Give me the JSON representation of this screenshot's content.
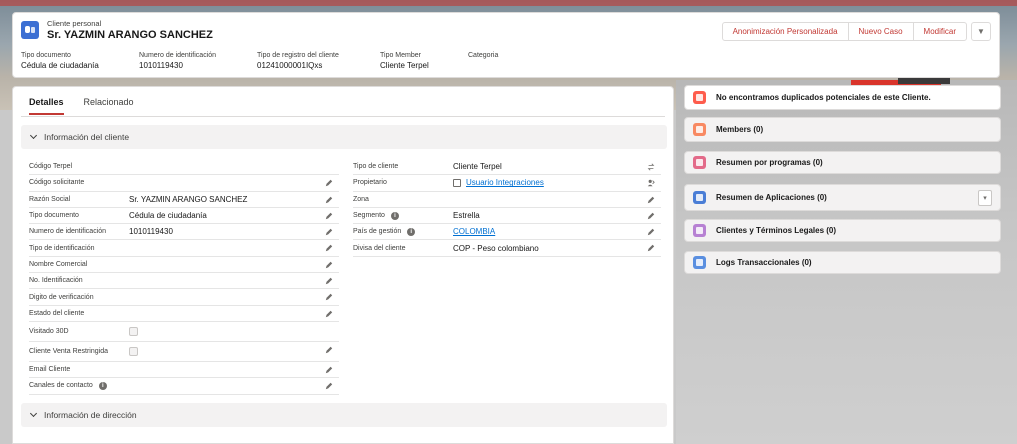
{
  "header": {
    "record_type": "Cliente personal",
    "record_name": "Sr. YAZMIN ARANGO SANCHEZ",
    "actions": [
      "Anonimización Personalizada",
      "Nuevo Caso",
      "Modificar"
    ],
    "highlights": [
      {
        "label": "Tipo documento",
        "value": "Cédula de ciudadanía"
      },
      {
        "label": "Numero de identificación",
        "value": "1010119430"
      },
      {
        "label": "Tipo de registro del cliente",
        "value": "01241000001IQxs"
      },
      {
        "label": "Tipo Member",
        "value": "Cliente Terpel"
      },
      {
        "label": "Categoria",
        "value": ""
      }
    ]
  },
  "tabs": [
    "Detalles",
    "Relacionado"
  ],
  "sections": {
    "client_info": "Información del cliente",
    "address_info": "Información de dirección"
  },
  "left_fields": [
    {
      "label": "Código Terpel",
      "value": ""
    },
    {
      "label": "Código solicitante",
      "value": ""
    },
    {
      "label": "Razón Social",
      "value": "Sr. YAZMIN ARANGO SANCHEZ"
    },
    {
      "label": "Tipo documento",
      "value": "Cédula de ciudadanía"
    },
    {
      "label": "Numero de identificación",
      "value": "1010119430"
    },
    {
      "label": "Tipo de identificación",
      "value": ""
    },
    {
      "label": "Nombre Comercial",
      "value": ""
    },
    {
      "label": "No. Identificación",
      "value": ""
    },
    {
      "label": "Digito de verificación",
      "value": ""
    },
    {
      "label": "Estado del cliente",
      "value": ""
    },
    {
      "label": "Visitado 30D",
      "value": ""
    },
    {
      "label": "Cliente Venta Restringida",
      "value": ""
    },
    {
      "label": "Email Cliente",
      "value": ""
    },
    {
      "label": "Canales de contacto",
      "value": ""
    }
  ],
  "right_fields": [
    {
      "label": "Tipo de cliente",
      "value": "Cliente Terpel"
    },
    {
      "label": "Propietario",
      "value": "Usuario Integraciones"
    },
    {
      "label": "Zona",
      "value": ""
    },
    {
      "label": "Segmento",
      "value": "Estrella"
    },
    {
      "label": "País de gestión",
      "value": "COLOMBIA"
    },
    {
      "label": "Divisa del cliente",
      "value": "COP - Peso colombiano"
    }
  ],
  "side_cards": [
    {
      "label": "No encontramos duplicados potenciales de este Cliente.",
      "color": "#fe5c4c",
      "icon": "duplicate-icon"
    },
    {
      "label": "Members (0)",
      "color": "#f88962",
      "icon": "members-icon"
    },
    {
      "label": "Resumen por programas (0)",
      "color": "#e36a89",
      "icon": "programs-icon"
    },
    {
      "label": "Resumen de Aplicaciones (0)",
      "color": "#4a7ed6",
      "icon": "applications-icon"
    },
    {
      "label": "Clientes y Términos Legales (0)",
      "color": "#b781d3",
      "icon": "legal-terms-icon"
    },
    {
      "label": "Logs Transaccionales (0)",
      "color": "#5a8fe0",
      "icon": "logs-icon"
    }
  ],
  "colors": {
    "accent": "#c23934",
    "link": "#0070d2"
  }
}
